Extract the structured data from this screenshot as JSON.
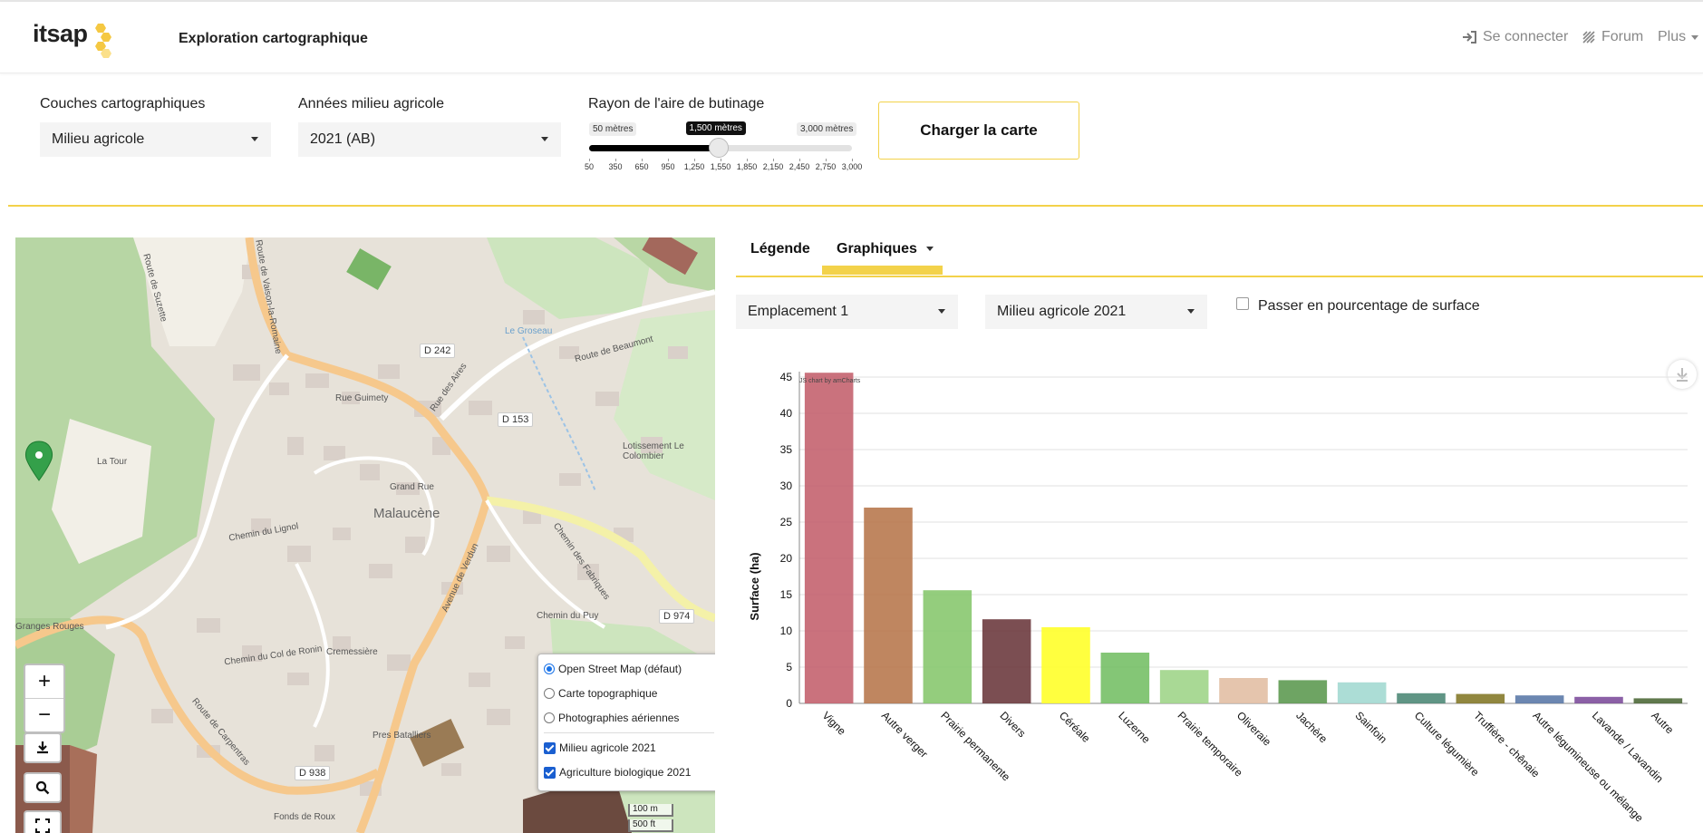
{
  "header": {
    "logo_text": "itsap",
    "title": "Exploration cartographique",
    "nav": [
      {
        "label": "Se connecter",
        "icon": "sign-in-icon"
      },
      {
        "label": "Forum",
        "icon": "forum-icon"
      },
      {
        "label": "Plus",
        "icon": "caret-down-icon"
      }
    ]
  },
  "controls": {
    "layers_label": "Couches cartographiques",
    "layers_value": "Milieu agricole",
    "years_label": "Années milieu agricole",
    "years_value": "2021 (AB)",
    "radius_label": "Rayon de l'aire de butinage",
    "slider": {
      "min_label": "50 mètres",
      "current_label": "1,500 mètres",
      "max_label": "3,000 mètres",
      "min": 50,
      "max": 3000,
      "value": 1500,
      "ticks": [
        "50",
        "350",
        "650",
        "950",
        "1,250",
        "1,550",
        "1,850",
        "2,150",
        "2,450",
        "2,750",
        "3,000"
      ]
    },
    "load_button": "Charger la carte"
  },
  "map": {
    "zoom_in": "+",
    "zoom_out": "−",
    "labels": [
      "La Tour",
      "Malaucène",
      "Cremessière",
      "Pres Batalliers",
      "Fonds de Roux",
      "Rue Guimety",
      "Grand Rue",
      "Chemin du Lignol",
      "Avenue de Verdun",
      "Route de Carpentras",
      "Chemin du Col de Ronin",
      "Route de Beaumont",
      "Lotissement Le Colombier",
      "Chemin des Fabriques",
      "Chemin du Puy",
      "Le Groseau",
      "Rue des Aires",
      "Route de Vaison-la-Romaine",
      "Route de Suzette",
      "Granges Rouges"
    ],
    "road_tags": [
      "D 242",
      "D 153",
      "D 974",
      "D 938"
    ],
    "layer_options": [
      {
        "label": "Open Street Map (défaut)",
        "selected": true
      },
      {
        "label": "Carte topographique",
        "selected": false
      },
      {
        "label": "Photographies aériennes",
        "selected": false
      }
    ],
    "overlays": [
      {
        "label": "Milieu agricole 2021",
        "checked": true
      },
      {
        "label": "Agriculture biologique 2021",
        "checked": true
      }
    ],
    "scale_m": "100 m",
    "scale_ft": "500 ft"
  },
  "panel": {
    "tab_legend": "Légende",
    "tab_charts": "Graphiques",
    "location_value": "Emplacement 1",
    "dataset_value": "Milieu agricole 2021",
    "percent_label": "Passer en pourcentage de surface",
    "credit": "JS chart by amCharts"
  },
  "chart_data": {
    "type": "bar",
    "ylabel": "Surface (ha)",
    "ylim": [
      0,
      45
    ],
    "yticks": [
      0,
      5,
      10,
      15,
      20,
      25,
      30,
      35,
      40,
      45
    ],
    "grid": true,
    "categories": [
      "Vigne",
      "Autre verger",
      "Prairie permanente",
      "Divers",
      "Céréale",
      "Luzerne",
      "Prairie temporaire",
      "Oliveraie",
      "Jachère",
      "Sainfoin",
      "Culture légumière",
      "Truffière - chênaie",
      "Autre légumineuse ou mélange",
      "Lavande / Lavandin",
      "Autre"
    ],
    "values": [
      45.6,
      27.0,
      15.6,
      11.6,
      10.5,
      7.0,
      4.6,
      3.5,
      3.2,
      2.9,
      1.4,
      1.3,
      1.1,
      0.9,
      0.7
    ],
    "colors": [
      "#c4636f",
      "#b8794f",
      "#88c86f",
      "#6d3b3f",
      "#ffff2a",
      "#77c067",
      "#a0d58a",
      "#e2bfa4",
      "#5e9a52",
      "#a3d9d2",
      "#4f8a78",
      "#857a2a",
      "#5c7aa8",
      "#7e4f9c",
      "#4f6a3a"
    ]
  }
}
